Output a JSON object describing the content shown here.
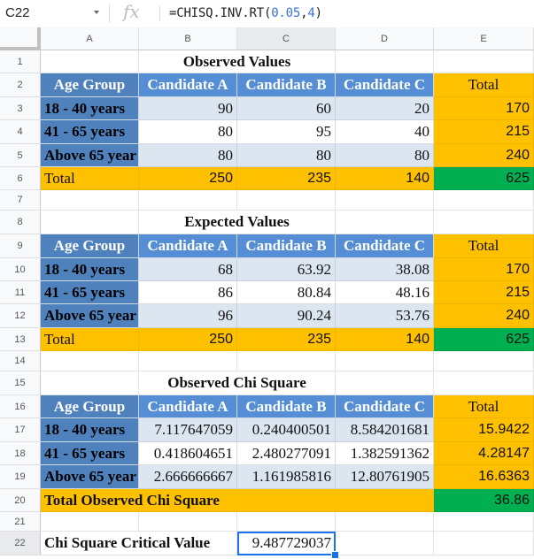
{
  "formula_bar": {
    "name_box": "C22",
    "fx_icon": "fx",
    "formula_prefix": "=CHISQ.INV.RT(",
    "formula_arg1": "0.05",
    "formula_sep": ",",
    "formula_arg2": "4",
    "formula_suffix": ")"
  },
  "columns": [
    "A",
    "B",
    "C",
    "D",
    "E"
  ],
  "selected_column": "C",
  "rows": [
    "1",
    "2",
    "3",
    "4",
    "5",
    "6",
    "7",
    "8",
    "9",
    "10",
    "11",
    "12",
    "13",
    "14",
    "15",
    "16",
    "17",
    "18",
    "19",
    "20",
    "21",
    "22"
  ],
  "selected_row": "22",
  "colors": {
    "header_dark_blue": "#4f81bd",
    "header_blue": "#558ed5",
    "light_blue": "#dce6f1",
    "orange": "#ffc000",
    "green": "#00b050",
    "selection": "#1a73e8"
  },
  "observed": {
    "title": "Observed Values",
    "headers": [
      "Age Group",
      "Candidate A",
      "Candidate B",
      "Candidate C",
      "Total"
    ],
    "rows": [
      {
        "label": "18 - 40 years",
        "values": [
          "90",
          "60",
          "20"
        ],
        "total": "170"
      },
      {
        "label": "41 - 65 years",
        "values": [
          "80",
          "95",
          "40"
        ],
        "total": "215"
      },
      {
        "label": "Above 65 year",
        "values": [
          "80",
          "80",
          "80"
        ],
        "total": "240"
      }
    ],
    "total_row": {
      "label": "Total",
      "values": [
        "250",
        "235",
        "140"
      ],
      "total": "625"
    }
  },
  "expected": {
    "title": "Expected Values",
    "headers": [
      "Age Group",
      "Candidate A",
      "Candidate B",
      "Candidate C",
      "Total"
    ],
    "rows": [
      {
        "label": "18 - 40 years",
        "values": [
          "68",
          "63.92",
          "38.08"
        ],
        "total": "170"
      },
      {
        "label": "41 - 65 years",
        "values": [
          "86",
          "80.84",
          "48.16"
        ],
        "total": "215"
      },
      {
        "label": "Above 65 year",
        "values": [
          "96",
          "90.24",
          "53.76"
        ],
        "total": "240"
      }
    ],
    "total_row": {
      "label": "Total",
      "values": [
        "250",
        "235",
        "140"
      ],
      "total": "625"
    }
  },
  "chi": {
    "title": "Observed Chi Square",
    "headers": [
      "Age Group",
      "Candidate A",
      "Candidate B",
      "Candidate C",
      "Total"
    ],
    "rows": [
      {
        "label": "18 - 40 years",
        "values": [
          "7.117647059",
          "0.240400501",
          "8.584201681"
        ],
        "total": "15.9422"
      },
      {
        "label": "41 - 65 years",
        "values": [
          "0.418604651",
          "2.480277091",
          "1.382591362"
        ],
        "total": "4.28147"
      },
      {
        "label": "Above 65 year",
        "values": [
          "2.666666667",
          "1.161985816",
          "12.80761905"
        ],
        "total": "16.6363"
      }
    ],
    "total_row": {
      "label": "Total Observed Chi Square",
      "total": "36.86"
    }
  },
  "critical": {
    "label": "Chi Square Critical Value",
    "value": "9.487729037"
  }
}
